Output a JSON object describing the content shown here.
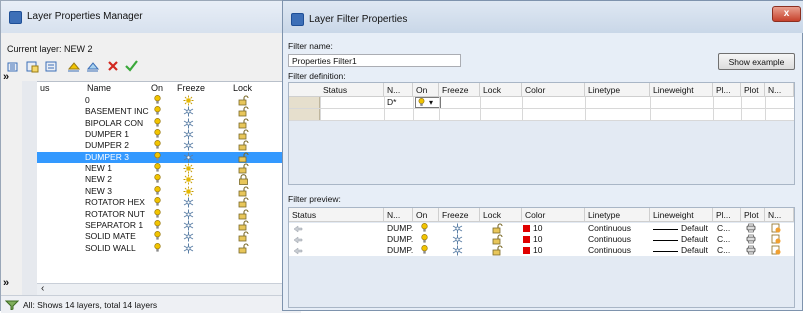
{
  "colors": {
    "selection": "#3399ff",
    "red_swatch": "#e00000",
    "bulb": "#f2c400",
    "sun": "#e6b800"
  },
  "lpm": {
    "title": "Layer Properties Manager",
    "current_layer": "Current layer: NEW 2",
    "columns": {
      "status": "us",
      "name": "Name",
      "on": "On",
      "freeze": "Freeze",
      "lock": "Lock"
    },
    "expand_label": "»",
    "scroll_left": "‹",
    "layers": [
      {
        "name": "0",
        "freeze": "sun"
      },
      {
        "name": "BASEMENT INC",
        "freeze": "snow"
      },
      {
        "name": "BIPOLAR CON",
        "freeze": "snow"
      },
      {
        "name": "DUMPER 1",
        "freeze": "snow"
      },
      {
        "name": "DUMPER 2",
        "freeze": "snow"
      },
      {
        "name": "DUMPER 3",
        "freeze": "snow",
        "selected": true
      },
      {
        "name": "NEW 1",
        "freeze": "sun"
      },
      {
        "name": "NEW 2",
        "freeze": "sun",
        "locked": true
      },
      {
        "name": "NEW 3",
        "freeze": "sun"
      },
      {
        "name": "ROTATOR HEX",
        "freeze": "snow"
      },
      {
        "name": "ROTATOR NUT",
        "freeze": "snow"
      },
      {
        "name": "SEPARATOR 1",
        "freeze": "snow"
      },
      {
        "name": "SOLID MATE",
        "freeze": "snow"
      },
      {
        "name": "SOLID WALL",
        "freeze": "snow"
      }
    ],
    "status_text": "All: Shows 14 layers, total 14 layers"
  },
  "lfp": {
    "title": "Layer Filter Properties",
    "close_label": "x",
    "filter_name_label": "Filter name:",
    "filter_name_value": "Properties Filter1",
    "show_example": "Show example",
    "filter_definition_label": "Filter definition:",
    "filter_preview_label": "Filter preview:",
    "def_columns": [
      "Status",
      "N...",
      "On",
      "Freeze",
      "Lock",
      "Color",
      "Linetype",
      "Lineweight",
      "Pl...",
      "Plot",
      "N..."
    ],
    "def_row": {
      "name": "D*",
      "on_dropdown": "▾"
    },
    "preview_columns": [
      "Status",
      "N...",
      "On",
      "Freeze",
      "Lock",
      "Color",
      "Linetype",
      "Lineweight",
      "Pl...",
      "Plot",
      "N..."
    ],
    "preview_rows": [
      {
        "name": "DUMP.",
        "color": "10",
        "linetype": "Continuous",
        "lineweight": "Default",
        "plotstyle": "C..."
      },
      {
        "name": "DUMP.",
        "color": "10",
        "linetype": "Continuous",
        "lineweight": "Default",
        "plotstyle": "C..."
      },
      {
        "name": "DUMP.",
        "color": "10",
        "linetype": "Continuous",
        "lineweight": "Default",
        "plotstyle": "C..."
      }
    ]
  }
}
